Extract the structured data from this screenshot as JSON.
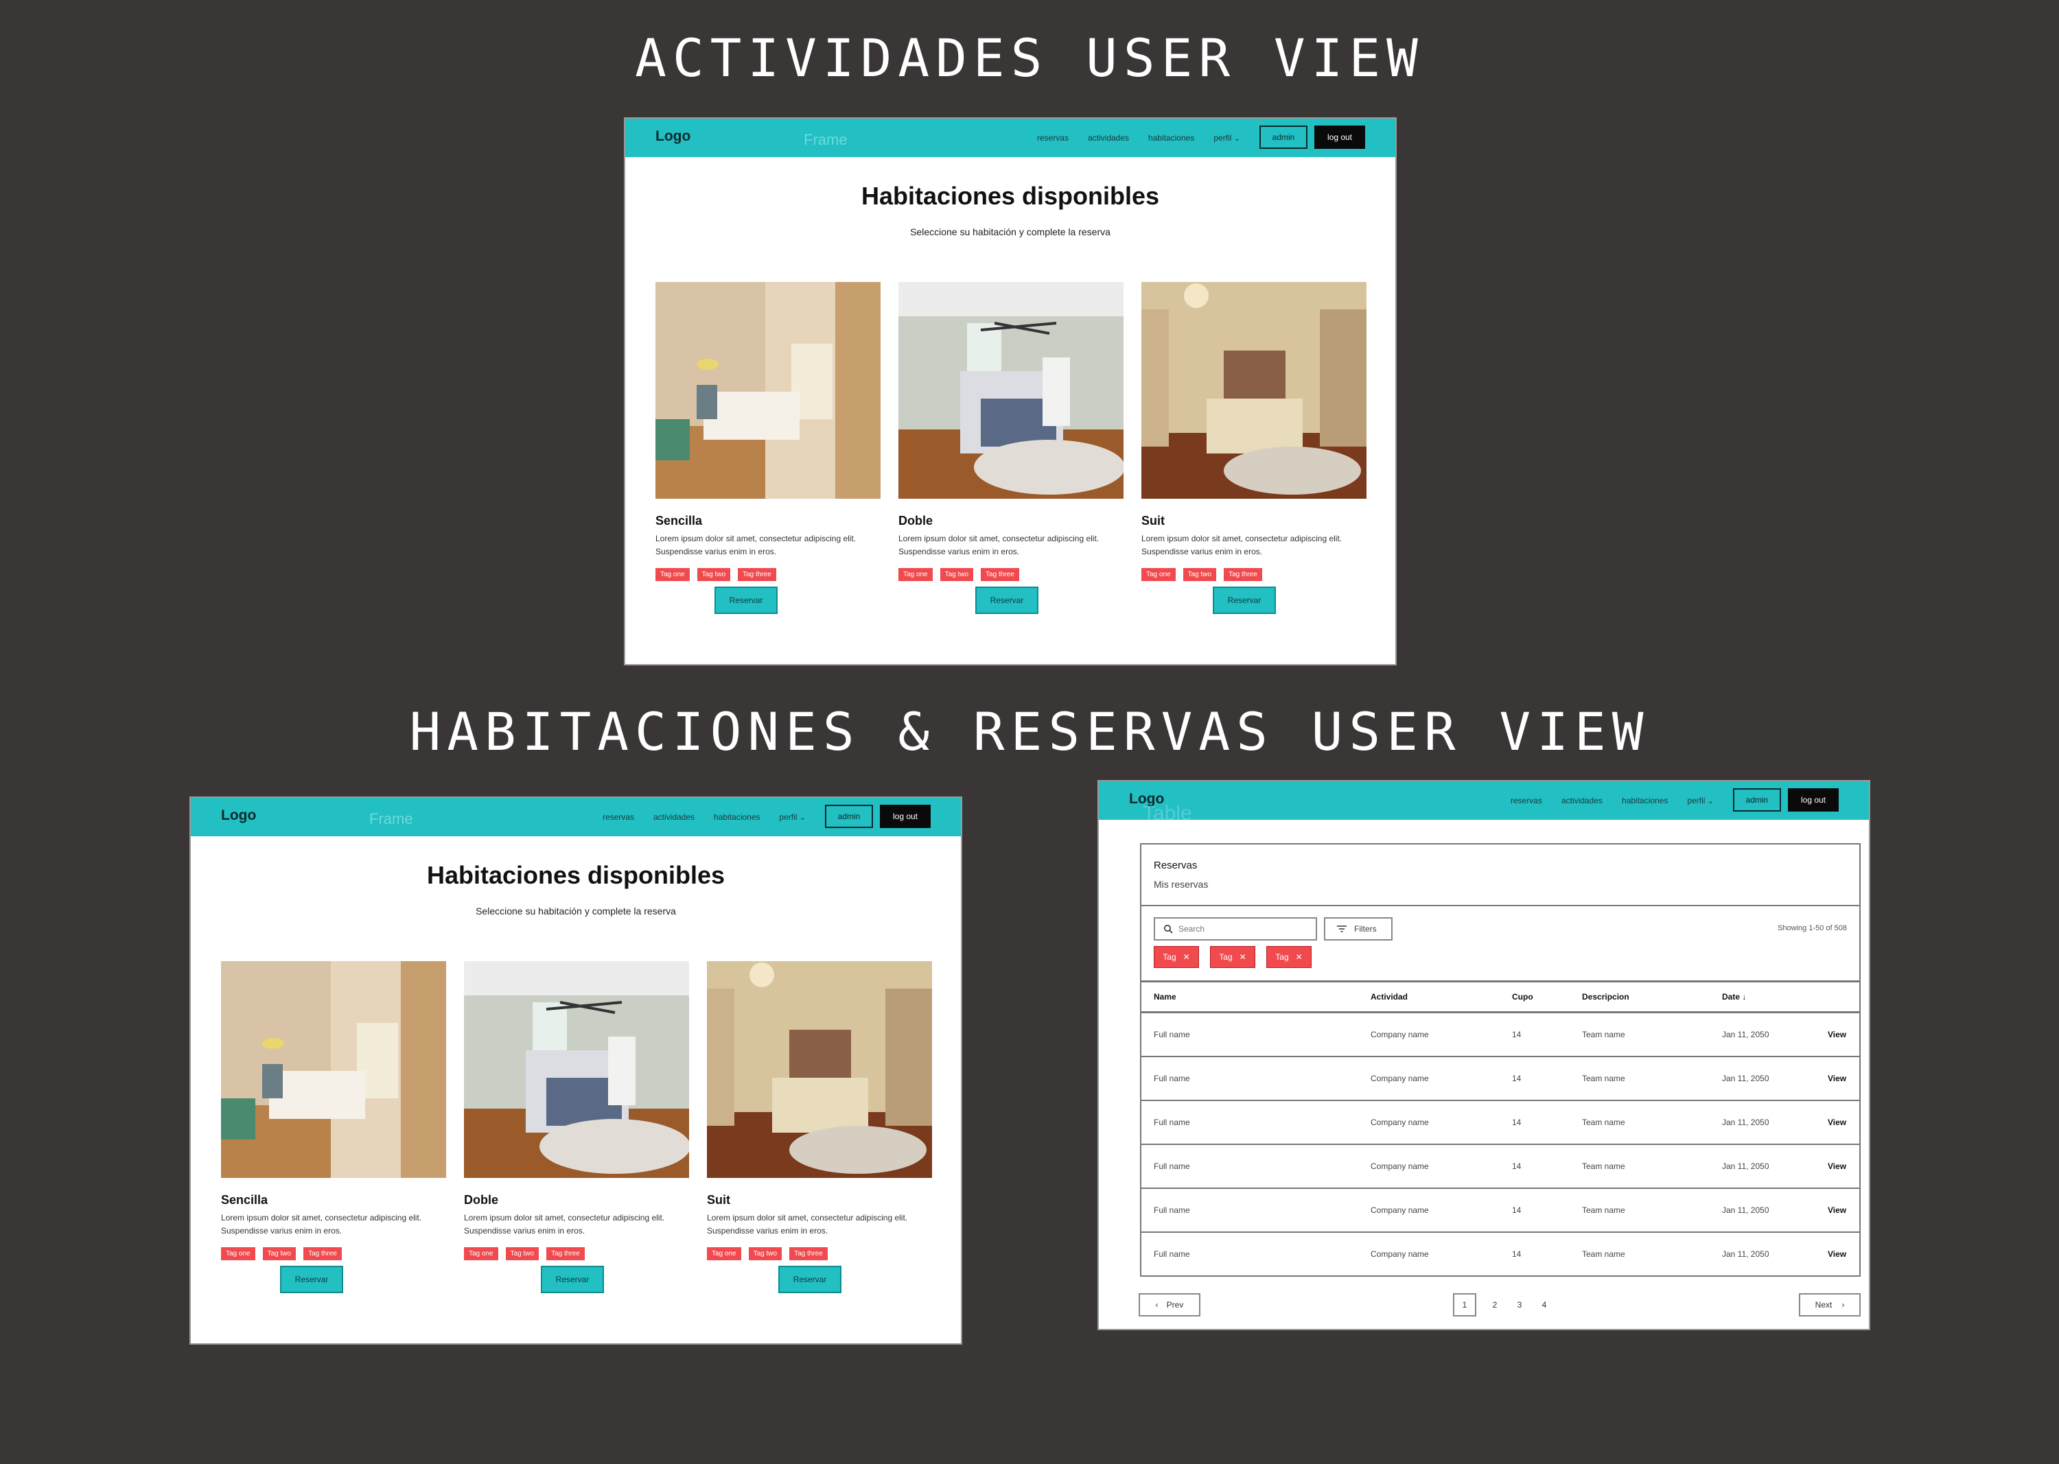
{
  "titles": {
    "top": "ACTIVIDADES USER VIEW",
    "bottom": "HABITACIONES & RESERVAS USER VIEW"
  },
  "nav": {
    "logo": "Logo",
    "frame_label": "Frame",
    "links": [
      "reservas",
      "actividades",
      "habitaciones",
      "perfil"
    ],
    "admin": "admin",
    "logout": "log out"
  },
  "rooms": {
    "heading": "Habitaciones disponibles",
    "subheading": "Seleccione su habitación y complete la reserva",
    "cards": [
      {
        "name": "Sencilla",
        "desc1": "Lorem ipsum dolor sit amet, consectetur adipiscing elit.",
        "desc2": "Suspendisse varius enim in eros.",
        "tags": [
          "Tag one",
          "Tag two",
          "Tag three"
        ],
        "button": "Reservar"
      },
      {
        "name": "Doble",
        "desc1": "Lorem ipsum dolor sit amet, consectetur adipiscing elit.",
        "desc2": "Suspendisse varius enim in eros.",
        "tags": [
          "Tag one",
          "Tag two",
          "Tag three"
        ],
        "button": "Reservar"
      },
      {
        "name": "Suit",
        "desc1": "Lorem ipsum dolor sit amet, consectetur adipiscing elit.",
        "desc2": "Suspendisse varius enim in eros.",
        "tags": [
          "Tag one",
          "Tag two",
          "Tag three"
        ],
        "button": "Reservar"
      }
    ]
  },
  "table_page": {
    "ghost_label": "Table",
    "title": "Reservas",
    "subtitle": "Mis reservas",
    "search_placeholder": "Search",
    "filters": "Filters",
    "showing": "Showing 1-50 of 508",
    "chips": [
      "Tag",
      "Tag",
      "Tag"
    ],
    "columns": [
      "Name",
      "Actividad",
      "Cupo",
      "Descripcion",
      "Date"
    ],
    "rows": [
      [
        "Full name",
        "Company name",
        "14",
        "Team name",
        "Jan 11, 2050",
        "View"
      ],
      [
        "Full name",
        "Company name",
        "14",
        "Team name",
        "Jan 11, 2050",
        "View"
      ],
      [
        "Full name",
        "Company name",
        "14",
        "Team name",
        "Jan 11, 2050",
        "View"
      ],
      [
        "Full name",
        "Company name",
        "14",
        "Team name",
        "Jan 11, 2050",
        "View"
      ],
      [
        "Full name",
        "Company name",
        "14",
        "Team name",
        "Jan 11, 2050",
        "View"
      ],
      [
        "Full name",
        "Company name",
        "14",
        "Team name",
        "Jan 11, 2050",
        "View"
      ]
    ],
    "prev": "Prev",
    "next": "Next",
    "pages": [
      "1",
      "2",
      "3",
      "4"
    ]
  },
  "colors": {
    "accent": "#22bfc3",
    "tag": "#f04a4f",
    "background": "#3a3636"
  }
}
